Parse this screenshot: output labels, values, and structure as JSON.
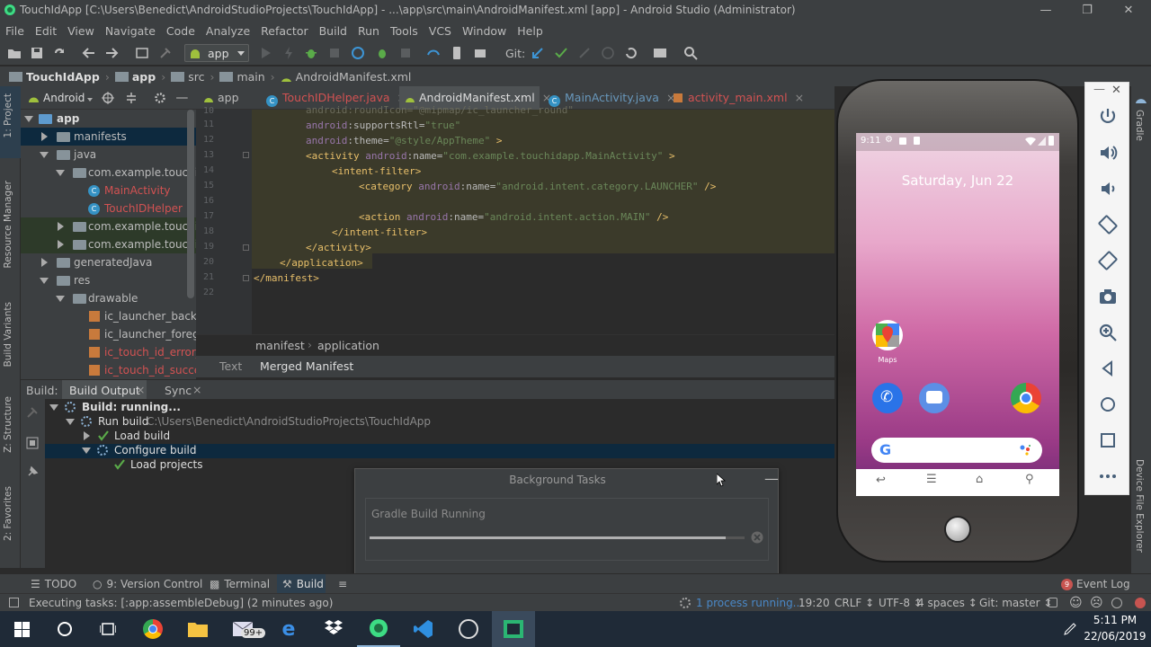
{
  "window": {
    "title": "TouchIdApp [C:\\Users\\Benedict\\AndroidStudioProjects\\TouchIdApp] - ...\\app\\src\\main\\AndroidManifest.xml [app] - Android Studio (Administrator)"
  },
  "menu": [
    "File",
    "Edit",
    "View",
    "Navigate",
    "Code",
    "Analyze",
    "Refactor",
    "Build",
    "Run",
    "Tools",
    "VCS",
    "Window",
    "Help"
  ],
  "toolbar": {
    "run_config": "app",
    "git_label": "Git:"
  },
  "breadcrumb": [
    "TouchIdApp",
    "app",
    "src",
    "main",
    "AndroidManifest.xml"
  ],
  "project_panel": {
    "view_label": "Android",
    "tree": [
      {
        "label": "app"
      },
      {
        "label": "manifests"
      },
      {
        "label": "java"
      },
      {
        "label": "com.example.touchida"
      },
      {
        "label": "MainActivity"
      },
      {
        "label": "TouchIDHelper"
      },
      {
        "label": "com.example.touchida"
      },
      {
        "label": "com.example.touchida"
      },
      {
        "label": "generatedJava"
      },
      {
        "label": "res"
      },
      {
        "label": "drawable"
      },
      {
        "label": "ic_launcher_backgro"
      },
      {
        "label": "ic_launcher_foregro"
      },
      {
        "label": "ic_touch_id_error_w"
      },
      {
        "label": "ic_touch_id_success"
      }
    ]
  },
  "side_tabs": {
    "project": "1: Project",
    "resource_manager": "Resource Manager",
    "build_variants": "Build Variants",
    "structure": "Z: Structure",
    "favorites": "2: Favorites",
    "gradle": "Gradle",
    "device_file_explorer": "Device File Explorer"
  },
  "editor_tabs": [
    "app",
    "TouchIDHelper.java",
    "AndroidManifest.xml",
    "MainActivity.java",
    "activity_main.xml"
  ],
  "code": {
    "line_numbers": [
      "10",
      "11",
      "12",
      "13",
      "14",
      "15",
      "16",
      "17",
      "18",
      "19",
      "20",
      "21",
      "22"
    ],
    "l10": "android:roundIcon=\"@mipmap/ic_launcher_round\"",
    "l11a": "android",
    "l11b": ":supportsRtl=",
    "l11c": "\"true\"",
    "l12a": "android",
    "l12b": ":theme=",
    "l12c": "\"@style/AppTheme\"",
    "l12d": " >",
    "l13a": "<activity ",
    "l13b": "android",
    "l13c": ":name=",
    "l13d": "\"com.example.touchidapp.MainActivity\"",
    "l13e": " >",
    "l14": "<intent-filter>",
    "l15a": "<category ",
    "l15b": "android",
    "l15c": ":name=",
    "l15d": "\"android.intent.category.LAUNCHER\"",
    "l15e": " />",
    "l17a": "<action ",
    "l17b": "android",
    "l17c": ":name=",
    "l17d": "\"android.intent.action.MAIN\"",
    "l17e": " />",
    "l18": "</intent-filter>",
    "l19": "</activity>",
    "l20": "</application>",
    "l21": "</manifest>"
  },
  "editor_breadcrumb": [
    "manifest",
    "application"
  ],
  "manifest_tabs": [
    "Text",
    "Merged Manifest"
  ],
  "build_panel": {
    "label": "Build:",
    "tabs": [
      "Build Output",
      "Sync"
    ],
    "rows": [
      {
        "text": "Build: running..."
      },
      {
        "text": "Run build",
        "path": "C:\\Users\\Benedict\\AndroidStudioProjects\\TouchIdApp"
      },
      {
        "text": "Load build"
      },
      {
        "text": "Configure build"
      },
      {
        "text": "Load projects"
      }
    ]
  },
  "background_tasks": {
    "title": "Background Tasks",
    "task": "Gradle Build Running",
    "progress": 0.95
  },
  "bottom_tabs": [
    "TODO",
    "9: Version Control",
    "Terminal",
    "Build"
  ],
  "event_log": {
    "label": "Event Log",
    "count": "9"
  },
  "status": {
    "message": "Executing tasks: [:app:assembleDebug] (2 minutes ago)",
    "process": "1 process running...",
    "position": "19:20",
    "line_sep": "CRLF ↕",
    "encoding": "UTF-8 ↕",
    "indent": "4 spaces ↕",
    "git": "Git: master ↕"
  },
  "emulator": {
    "status_time": "9:11",
    "date": "Saturday, Jun 22",
    "maps_label": "Maps",
    "search_logo": "G"
  },
  "taskbar": {
    "time": "5:11 PM",
    "date": "22/06/2019",
    "mail_badge": "99+"
  },
  "colors": {
    "accent": "#4a88c7",
    "selected": "#0d293e",
    "success": "#5aab49"
  }
}
